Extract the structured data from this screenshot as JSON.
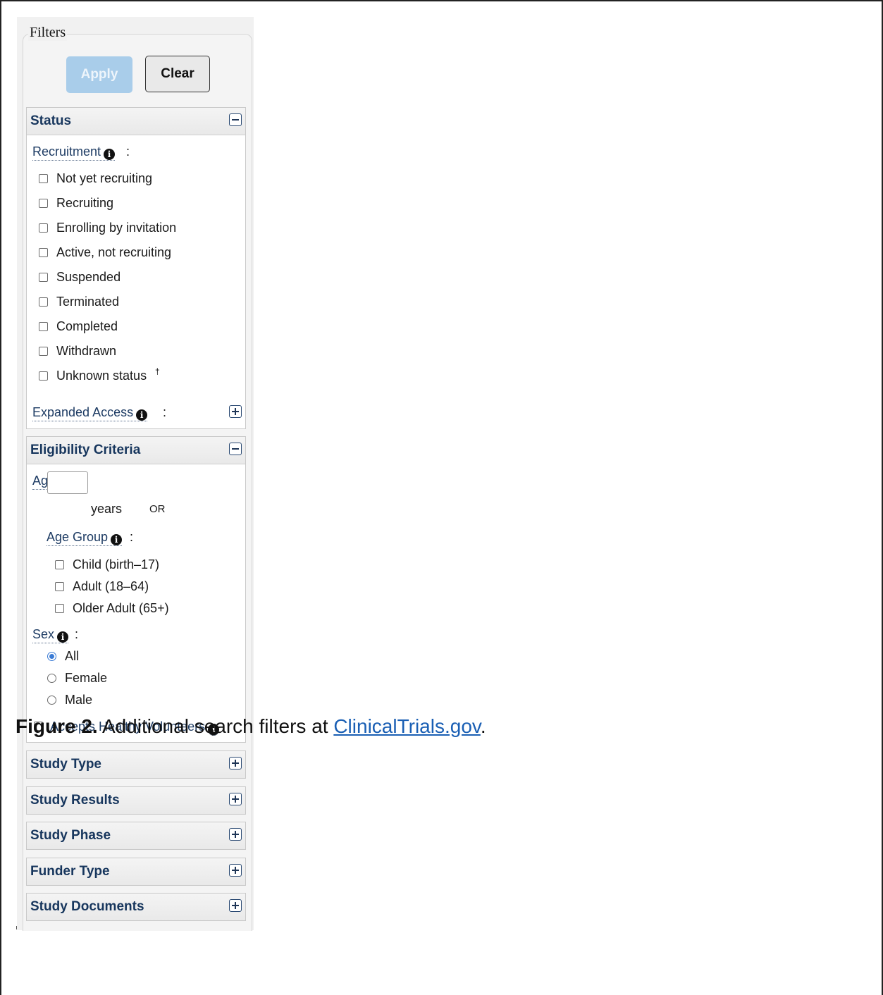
{
  "filters": {
    "legend": "Filters",
    "apply_label": "Apply",
    "clear_label": "Clear"
  },
  "status": {
    "title": "Status",
    "recruitment_label": "Recruitment",
    "recruitment_options": [
      "Not yet recruiting",
      "Recruiting",
      "Enrolling by invitation",
      "Active, not recruiting",
      "Suspended",
      "Terminated",
      "Completed",
      "Withdrawn",
      "Unknown status"
    ],
    "unknown_marker": "†",
    "expanded_access_label": "Expanded Access"
  },
  "eligibility": {
    "title": "Eligibility Criteria",
    "age_label": "Age",
    "age_value": "",
    "years_label": "years",
    "or_label": "OR",
    "age_group_label": "Age Group",
    "age_groups": [
      "Child (birth–17)",
      "Adult (18–64)",
      "Older Adult (65+)"
    ],
    "sex_label": "Sex",
    "sex_options": [
      "All",
      "Female",
      "Male"
    ],
    "sex_selected": "All",
    "healthy_volunteers_label": "Accepts Healthy Volunteers"
  },
  "collapsed_sections": [
    "Study Type",
    "Study Results",
    "Study Phase",
    "Funder Type",
    "Study Documents"
  ],
  "caption": {
    "prefix": "Figure 2.",
    "text": " Additional search filters at ",
    "link": "ClinicalTrials.gov",
    "suffix": "."
  },
  "colors": {
    "section_title": "#17365d",
    "apply_button": "#a9cdea",
    "link": "#1a5fb4",
    "radio_selected": "#3a7bd5"
  },
  "icons": [
    "info-icon",
    "collapse-icon",
    "expand-icon"
  ]
}
